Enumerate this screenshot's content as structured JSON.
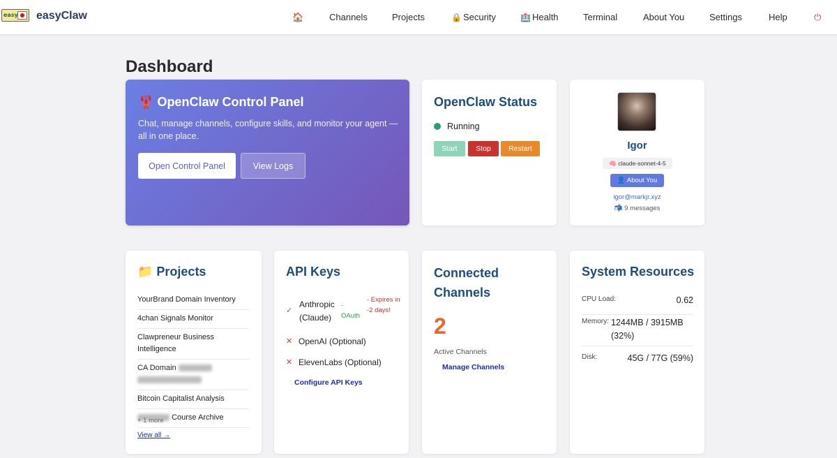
{
  "nav": {
    "brand": "easyClaw",
    "home_icon": "🏠",
    "items": [
      "Channels",
      "Projects",
      "Security",
      "Health",
      "Terminal",
      "About You",
      "Settings",
      "Help"
    ],
    "security_icon": "🔒",
    "health_icon": "🏥",
    "power_icon": "⏻"
  },
  "page": {
    "title": "Dashboard"
  },
  "hero": {
    "icon": "🦞",
    "title": "OpenClaw Control Panel",
    "description": "Chat, manage channels, configure skills, and monitor your agent — all in one place.",
    "open_button": "Open Control Panel",
    "logs_button": "View Logs"
  },
  "status": {
    "title": "OpenClaw Status",
    "state": "Running",
    "start": "Start",
    "stop": "Stop",
    "restart": "Restart",
    "colors": {
      "running": "#2f9e6f",
      "start": "#8fd3b8",
      "stop": "#c8322f",
      "restart": "#e88a2c"
    }
  },
  "profile": {
    "name": "Igor",
    "model": "🧠 claude-sonnet-4-5",
    "about_button": "👤 About You",
    "email": "igor@markjr.xyz",
    "messages": "📬 9 messages"
  },
  "projects": {
    "title": "📁 Projects",
    "items": [
      "YourBrand Domain Inventory",
      "4chan Signals Monitor",
      "Clawpreneur Business Intelligence",
      "CA Domain",
      "Bitcoin Capitalist Analysis",
      "Course Archive"
    ],
    "more": "+ 1 more",
    "view_all": "View all →"
  },
  "api_keys": {
    "title": "API Keys",
    "keys": [
      {
        "mark": "✓",
        "name": "Anthropic (Claude)",
        "method": "- OAuth",
        "note": "- Expires in -2 days!"
      },
      {
        "mark": "✕",
        "name": "OpenAI (Optional)"
      },
      {
        "mark": "✕",
        "name": "ElevenLabs (Optional)"
      }
    ],
    "configure": "Configure API Keys",
    "colors": {
      "ok": "#2e9a4f",
      "missing": "#d33a2c",
      "warn": "#c8322f"
    }
  },
  "channels": {
    "title": "Connected Channels",
    "count": "2",
    "label": "Active Channels",
    "manage": "Manage Channels"
  },
  "resources": {
    "title": "System Resources",
    "cpu_label": "CPU Load:",
    "cpu_value": "0.62",
    "mem_label": "Memory:",
    "mem_value": "1244MB / 3915MB (32%)",
    "disk_label": "Disk:",
    "disk_value": "45G / 77G (59%)"
  }
}
